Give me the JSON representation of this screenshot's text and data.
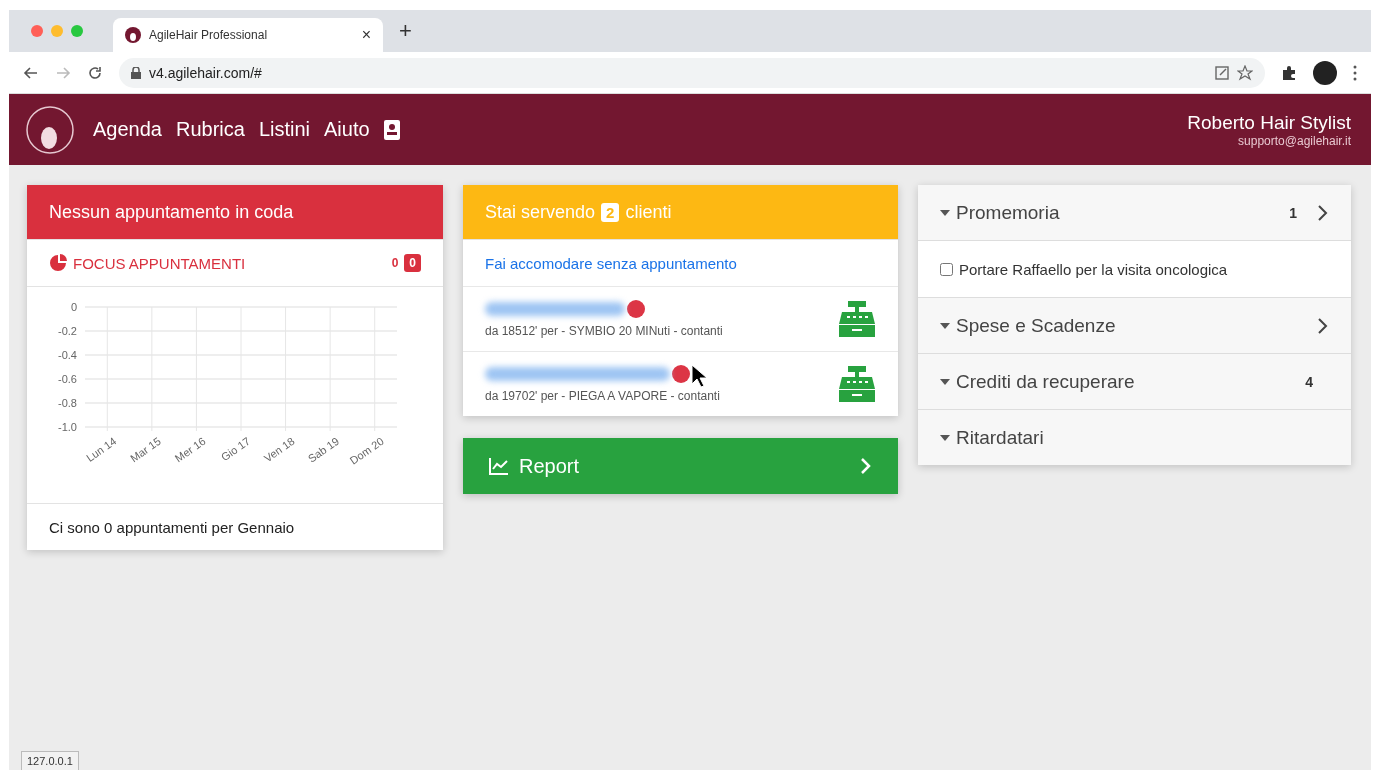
{
  "browser": {
    "tab_title": "AgileHair Professional",
    "tab_close": "×",
    "new_tab": "+",
    "url": "v4.agilehair.com/#",
    "status_url": "127.0.0.1"
  },
  "nav": {
    "items": [
      "Agenda",
      "Rubrica",
      "Listini",
      "Aiuto"
    ],
    "user_name": "Roberto Hair Stylist",
    "user_email": "supporto@agilehair.it"
  },
  "queue_card": {
    "title": "Nessun appuntamento in coda",
    "focus_title": "FOCUS APPUNTAMENTI",
    "focus_count": "0",
    "focus_badge": "0",
    "chart_data": {
      "type": "line",
      "grid": true,
      "categories": [
        "Lun 14",
        "Mar 15",
        "Mer 16",
        "Gio 17",
        "Ven 18",
        "Sab 19",
        "Dom 20"
      ],
      "ylim": [
        -1,
        0
      ],
      "yticks": [
        {
          "value": 0,
          "label": "0"
        },
        {
          "value": -0.2,
          "label": "-0.2"
        },
        {
          "value": -0.4,
          "label": "-0.4"
        },
        {
          "value": -0.6,
          "label": "-0.6"
        },
        {
          "value": -0.8,
          "label": "-0.8"
        },
        {
          "value": -1,
          "label": "-1.0"
        }
      ]
    },
    "footer": "Ci sono 0 appuntamenti per Gennaio"
  },
  "serving_card": {
    "title_before": "Stai servendo",
    "count": "2",
    "title_after": "clienti",
    "walk_in_link": "Fai accomodare senza appuntamento",
    "clients": [
      {
        "detail": "da 18512' per - SYMBIO 20 MINuti - contanti",
        "color": "#dc3545"
      },
      {
        "detail": "da 19702' per - PIEGA A VAPORE - contanti",
        "color": "#dc3545"
      }
    ]
  },
  "report_button": {
    "label": "Report"
  },
  "side_panel": {
    "sections": [
      {
        "title": "Promemoria",
        "count": "1",
        "has_arrow": true,
        "items": [
          {
            "text": "Portare Raffaello per la visita oncologica",
            "checked": false
          }
        ]
      },
      {
        "title": "Spese e Scadenze",
        "has_arrow": true
      },
      {
        "title": "Crediti da recuperare",
        "count": "4"
      },
      {
        "title": "Ritardatari"
      }
    ]
  }
}
